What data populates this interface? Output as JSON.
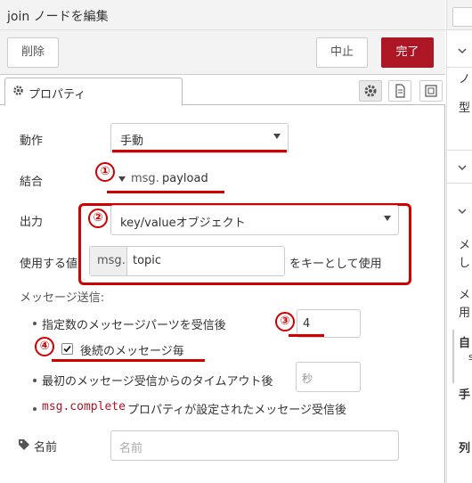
{
  "dialog": {
    "title": "join ノードを編集",
    "delete_label": "削除",
    "cancel_label": "中止",
    "done_label": "完了"
  },
  "tabs": {
    "properties_label": "プロパティ"
  },
  "form": {
    "mode_label": "動作",
    "mode_value": "手動",
    "combine_label": "結合",
    "combine_prefix": "msg.",
    "combine_value": "payload",
    "output_label": "出力",
    "output_value": "key/valueオブジェクト",
    "key_label": "使用する値",
    "key_prefix": "msg.",
    "key_value": "topic",
    "key_suffix": "をキーとして使用",
    "send_heading": "メッセージ送信:",
    "count_label": "指定数のメッセージパーツを受信後",
    "count_value": "4",
    "each_label": "後続のメッセージ毎",
    "each_checked": true,
    "timeout_label": "最初のメッセージ受信からのタイムアウト後",
    "timeout_placeholder": "秒",
    "complete_prefix": "msg.complete",
    "complete_label": "プロパティが設定されたメッセージ受信後",
    "name_label": "名前",
    "name_placeholder": "名前"
  },
  "annotations": {
    "markers": [
      "①",
      "②",
      "③",
      "④"
    ],
    "color": "#d00000"
  },
  "sidebar": {
    "items": [
      "ノ",
      "型",
      "メ",
      "し",
      "メ",
      "用",
      "自",
      "s",
      "手",
      "列"
    ]
  },
  "colors": {
    "accent": "#ad1625"
  }
}
